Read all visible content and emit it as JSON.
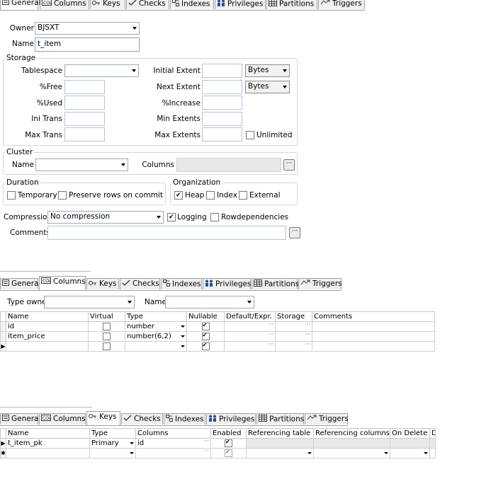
{
  "tabs": [
    "General",
    "Columns",
    "Keys",
    "Checks",
    "Indexes",
    "Privileges",
    "Partitions",
    "Triggers"
  ],
  "general": {
    "owner_label": "Owner",
    "owner_value": "BJSXT",
    "name_label": "Name",
    "name_value": "t_item",
    "storage": {
      "title": "Storage",
      "tablespace_label": "Tablespace",
      "tablespace_value": "",
      "free_label": "%Free",
      "used_label": "%Used",
      "ini_trans_label": "Ini Trans",
      "max_trans_label": "Max Trans",
      "initial_extent_label": "Initial Extent",
      "initial_extent_unit": "Bytes",
      "next_extent_label": "Next Extent",
      "next_extent_unit": "Bytes",
      "increase_label": "%Increase",
      "min_extents_label": "Min Extents",
      "max_extents_label": "Max Extents",
      "unlimited_label": "Unlimited"
    },
    "cluster": {
      "title": "Cluster",
      "name_label": "Name",
      "name_value": "",
      "columns_label": "Columns",
      "columns_value": ""
    },
    "duration": {
      "title": "Duration",
      "temporary_label": "Temporary",
      "preserve_label": "Preserve rows on commit"
    },
    "organization": {
      "title": "Organization",
      "heap_label": "Heap",
      "index_label": "Index",
      "external_label": "External"
    },
    "compression_label": "Compression",
    "compression_value": "No compression",
    "logging_label": "Logging",
    "rowdependencies_label": "Rowdependencies",
    "comments_label": "Comments",
    "comments_value": ""
  },
  "columns_tab": {
    "type_owner_label": "Type owner",
    "type_owner_value": "",
    "name_label": "Name",
    "name_value": "",
    "headers": [
      "Name",
      "Virtual",
      "Type",
      "Nullable",
      "Default/Expr.",
      "Storage",
      "Comments"
    ],
    "rows": [
      {
        "name": "id",
        "type": "number"
      },
      {
        "name": "item_price",
        "type": "number(6,2)"
      },
      {
        "name": "",
        "type": ""
      }
    ]
  },
  "keys_tab": {
    "headers": [
      "Name",
      "Type",
      "Columns",
      "Enabled",
      "Referencing table",
      "Referencing columns",
      "On Delete",
      "D"
    ],
    "rows": [
      {
        "name": "t_item_pk",
        "type": "Primary",
        "columns": "id"
      },
      {
        "name": "",
        "type": "",
        "columns": ""
      }
    ]
  },
  "colors": {
    "tab_border": "#a0a0a0",
    "grid_line": "#d0d0d0",
    "input_border": "#b7c4d6",
    "disabled_fill": "#e8e8e8"
  }
}
